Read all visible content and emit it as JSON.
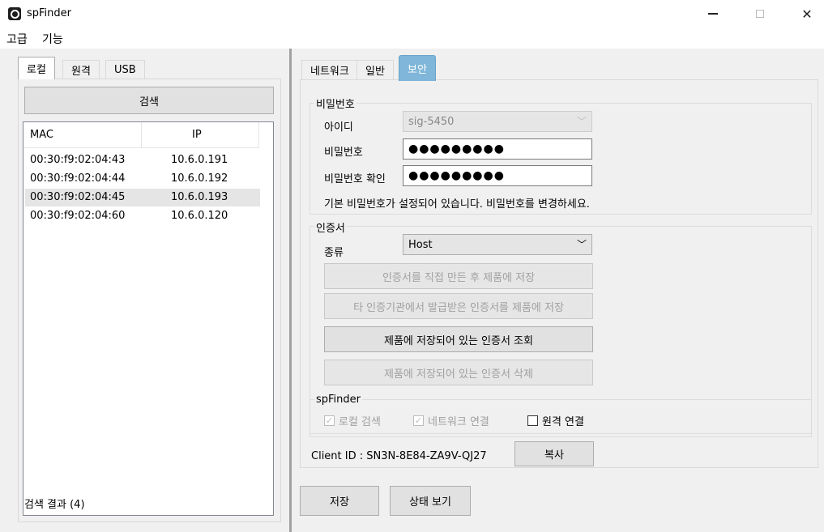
{
  "window": {
    "title": "spFinder",
    "minimize_glyph": "—",
    "maximize_glyph": "□",
    "close_glyph": "✕"
  },
  "menu": {
    "items": [
      "고급",
      "기능"
    ]
  },
  "left": {
    "tabs": [
      "로컬",
      "원격",
      "USB"
    ],
    "search_button": "검색",
    "columns": {
      "mac": "MAC",
      "ip": "IP"
    },
    "rows": [
      {
        "mac": "00:30:f9:02:04:43",
        "ip": "10.6.0.191"
      },
      {
        "mac": "00:30:f9:02:04:44",
        "ip": "10.6.0.192"
      },
      {
        "mac": "00:30:f9:02:04:45",
        "ip": "10.6.0.193"
      },
      {
        "mac": "00:30:f9:02:04:60",
        "ip": "10.6.0.120"
      }
    ],
    "result_label": "검색 결과 (4)"
  },
  "right": {
    "tabs": [
      "네트워크",
      "일반",
      "보안"
    ],
    "password_group": {
      "title": "비밀번호",
      "id_label": "아이디",
      "id_value": "sig-5450",
      "password_label": "비밀번호",
      "password_value": "●●●●●●●●●",
      "confirm_label": "비밀번호 확인",
      "confirm_value": "●●●●●●●●●",
      "notice": "기본 비밀번호가 설정되어 있습니다. 비밀번호를 변경하세요."
    },
    "cert_group": {
      "title": "인증서",
      "type_label": "종류",
      "type_value": "Host",
      "btn_create": "인증서를 직접 만든 후 제품에 저장",
      "btn_external": "타 인증기관에서 발급받은 인증서를 제품에 저장",
      "btn_view": "제품에 저장되어 있는 인증서 조회",
      "btn_delete": "제품에 저장되어 있는 인증서 삭제"
    },
    "spfinder_group": {
      "title": "spFinder",
      "local_search": "로컬 검색",
      "network_connect": "네트워크 연결",
      "remote_connect": "원격 연결",
      "check_mark": "✓"
    },
    "client_id": "Client ID : SN3N-8E84-ZA9V-QJ27",
    "copy_button": "복사",
    "save_button": "저장",
    "status_button": "상태 보기"
  },
  "colors": {
    "active_tab_highlight": "#7fb6d9"
  }
}
